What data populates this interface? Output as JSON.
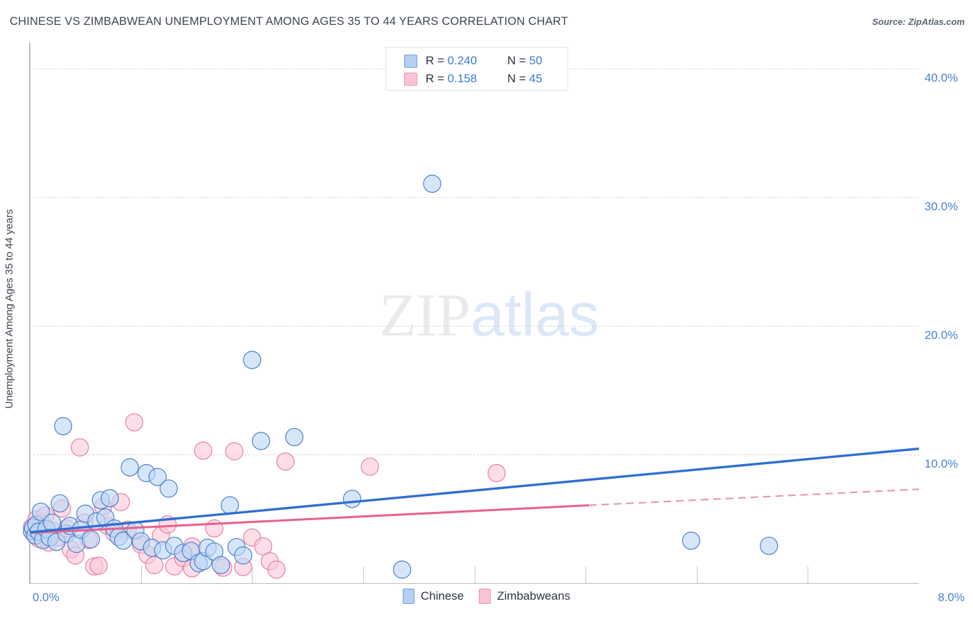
{
  "header": {
    "title": "CHINESE VS ZIMBABWEAN UNEMPLOYMENT AMONG AGES 35 TO 44 YEARS CORRELATION CHART",
    "source": "Source: ZipAtlas.com"
  },
  "watermark": {
    "part1": "ZIP",
    "part2": "atlas"
  },
  "stats": {
    "rows": [
      {
        "color_key": "blue",
        "r_label": "R =",
        "r_value": "0.240",
        "n_label": "N =",
        "n_value": "50"
      },
      {
        "color_key": "pink",
        "r_label": "R =",
        "r_value": "0.158",
        "n_label": "N =",
        "n_value": "45"
      }
    ]
  },
  "colors": {
    "blue_fill": "#bdd7f5",
    "blue_stroke": "#4a81cc",
    "pink_fill": "#fbc9d8",
    "pink_stroke": "#e87fa5",
    "trend_blue": "#2f6fd0",
    "trend_pink": "#e8628c",
    "axis_text": "#4a7fd4",
    "title_text": "#3d4451"
  },
  "chart_data": {
    "type": "scatter",
    "title": "CHINESE VS ZIMBABWEAN UNEMPLOYMENT AMONG AGES 35 TO 44 YEARS CORRELATION CHART",
    "xlabel": "",
    "ylabel": "Unemployment Among Ages 35 to 44 years",
    "xlim": [
      0.0,
      8.0
    ],
    "ylim": [
      0.0,
      42.0
    ],
    "x_tick_labels": [
      "0.0%",
      "8.0%"
    ],
    "y_tick_labels": [
      "10.0%",
      "20.0%",
      "30.0%",
      "40.0%"
    ],
    "y_ticks": [
      10.0,
      20.0,
      30.0,
      40.0
    ],
    "grid": true,
    "legend_position": "bottom-center",
    "series": [
      {
        "name": "Chinese",
        "color": "#bdd7f5",
        "r": 0.24,
        "n": 50,
        "trendline": {
          "x0": 0.0,
          "y0": 3.95,
          "x1": 8.0,
          "y1": 10.45,
          "style": "solid"
        },
        "points": [
          [
            0.02,
            4.05
          ],
          [
            0.03,
            4.3
          ],
          [
            0.05,
            3.7
          ],
          [
            0.06,
            4.55
          ],
          [
            0.08,
            4.0
          ],
          [
            0.1,
            5.55
          ],
          [
            0.12,
            3.35
          ],
          [
            0.15,
            4.2
          ],
          [
            0.18,
            3.55
          ],
          [
            0.2,
            4.7
          ],
          [
            0.24,
            3.2
          ],
          [
            0.27,
            6.2
          ],
          [
            0.3,
            12.2
          ],
          [
            0.33,
            3.85
          ],
          [
            0.36,
            4.45
          ],
          [
            0.42,
            3.05
          ],
          [
            0.46,
            4.15
          ],
          [
            0.5,
            5.4
          ],
          [
            0.55,
            3.4
          ],
          [
            0.6,
            4.8
          ],
          [
            0.64,
            6.45
          ],
          [
            0.68,
            5.1
          ],
          [
            0.72,
            6.6
          ],
          [
            0.76,
            4.25
          ],
          [
            0.8,
            3.6
          ],
          [
            0.84,
            3.3
          ],
          [
            0.9,
            9.0
          ],
          [
            0.95,
            4.1
          ],
          [
            1.0,
            3.25
          ],
          [
            1.05,
            8.55
          ],
          [
            1.1,
            2.75
          ],
          [
            1.15,
            8.25
          ],
          [
            1.2,
            2.55
          ],
          [
            1.25,
            7.35
          ],
          [
            1.3,
            2.9
          ],
          [
            1.38,
            2.35
          ],
          [
            1.45,
            2.5
          ],
          [
            1.52,
            1.55
          ],
          [
            1.56,
            1.7
          ],
          [
            1.6,
            2.75
          ],
          [
            1.66,
            2.45
          ],
          [
            1.72,
            1.4
          ],
          [
            1.8,
            6.05
          ],
          [
            1.86,
            2.8
          ],
          [
            1.92,
            2.15
          ],
          [
            2.0,
            17.35
          ],
          [
            2.08,
            11.05
          ],
          [
            2.38,
            11.35
          ],
          [
            2.9,
            6.55
          ],
          [
            3.62,
            31.05
          ],
          [
            3.35,
            1.05
          ],
          [
            5.95,
            3.3
          ],
          [
            6.65,
            2.9
          ]
        ]
      },
      {
        "name": "Zimbabweans",
        "color": "#fbc9d8",
        "r": 0.158,
        "n": 45,
        "trendline": {
          "x0": 0.0,
          "y0": 3.9,
          "x1": 5.03,
          "y1": 6.05,
          "style": "solid"
        },
        "trendline_extension": {
          "x0": 5.03,
          "y0": 6.05,
          "x1": 8.0,
          "y1": 7.3,
          "style": "dashed"
        },
        "points": [
          [
            0.02,
            4.35
          ],
          [
            0.04,
            3.8
          ],
          [
            0.06,
            4.95
          ],
          [
            0.08,
            3.45
          ],
          [
            0.11,
            4.6
          ],
          [
            0.14,
            5.25
          ],
          [
            0.17,
            3.15
          ],
          [
            0.21,
            4.05
          ],
          [
            0.25,
            3.55
          ],
          [
            0.29,
            5.8
          ],
          [
            0.33,
            4.25
          ],
          [
            0.37,
            2.6
          ],
          [
            0.41,
            2.15
          ],
          [
            0.45,
            10.55
          ],
          [
            0.49,
            4.7
          ],
          [
            0.53,
            3.35
          ],
          [
            0.58,
            1.3
          ],
          [
            0.62,
            1.35
          ],
          [
            0.66,
            5.95
          ],
          [
            0.7,
            4.45
          ],
          [
            0.76,
            3.9
          ],
          [
            0.82,
            6.3
          ],
          [
            0.88,
            4.15
          ],
          [
            0.94,
            12.5
          ],
          [
            1.0,
            3.0
          ],
          [
            1.06,
            2.2
          ],
          [
            1.12,
            1.4
          ],
          [
            1.18,
            3.7
          ],
          [
            1.24,
            4.55
          ],
          [
            1.3,
            1.3
          ],
          [
            1.38,
            1.95
          ],
          [
            1.46,
            2.85
          ],
          [
            1.56,
            10.3
          ],
          [
            1.66,
            4.25
          ],
          [
            1.74,
            1.2
          ],
          [
            1.84,
            10.25
          ],
          [
            1.92,
            1.25
          ],
          [
            2.0,
            3.55
          ],
          [
            2.1,
            2.85
          ],
          [
            2.16,
            1.7
          ],
          [
            2.22,
            1.05
          ],
          [
            2.3,
            9.45
          ],
          [
            3.06,
            9.05
          ],
          [
            4.2,
            8.55
          ],
          [
            1.46,
            1.15
          ]
        ]
      }
    ]
  }
}
